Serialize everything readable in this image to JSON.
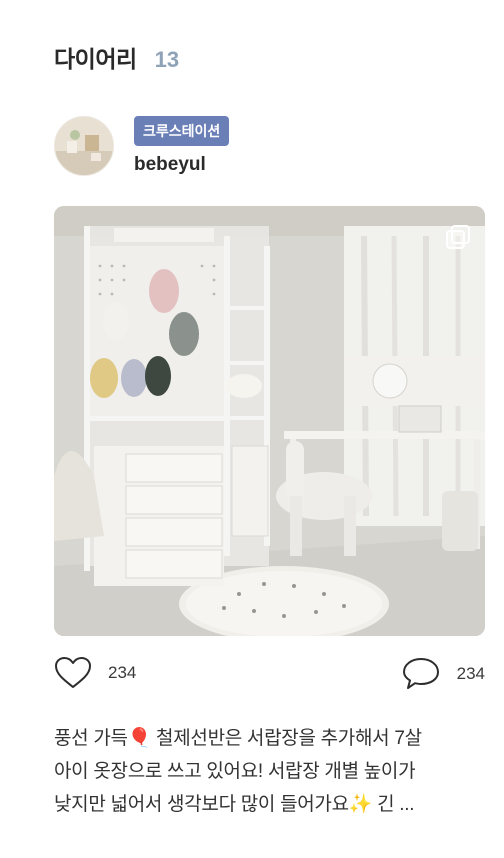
{
  "header": {
    "title": "다이어리",
    "count": "13"
  },
  "author": {
    "badge": "크루스테이션",
    "username": "bebeyul"
  },
  "post": {
    "image_alt": "White room with metal shelving, pegboard with hanging balloons, drawer unit, white desk and chair",
    "multi_image_icon": "multi-image-icon",
    "likes": "234",
    "comments": "234",
    "caption_lines": [
      "풍선 가득🎈 철제선반은 서랍장을 추가해서 7살",
      "아이 옷장으로 쓰고 있어요! 서랍장 개별 높이가",
      "낮지만 넓어서 생각보다 많이 들어가요✨ 긴 ..."
    ]
  },
  "icons": {
    "like": "heart-icon",
    "comment": "speech-bubble-icon"
  },
  "colors": {
    "badge": "#6b7fb7",
    "count": "#8fa3b8",
    "text": "#2b2b2b"
  }
}
